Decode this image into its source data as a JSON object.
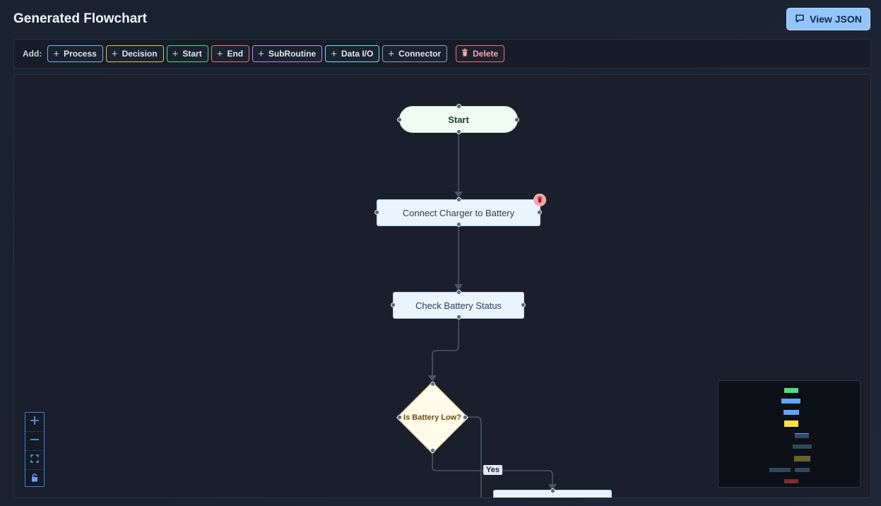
{
  "header": {
    "title": "Generated Flowchart",
    "view_json_label": "View JSON"
  },
  "toolbar": {
    "add_label": "Add:",
    "buttons": [
      "Process",
      "Decision",
      "Start",
      "End",
      "SubRoutine",
      "Data I/O",
      "Connector"
    ],
    "delete_label": "Delete"
  },
  "nodes": {
    "start": "Start",
    "process1": "Connect Charger to Battery",
    "process2": "Check Battery Status",
    "decision": "Is Battery Low?",
    "process3": ""
  },
  "edge_labels": {
    "yes": "Yes"
  },
  "colors": {
    "accent": "#93c5fd",
    "start_fill": "#effdf3",
    "process_fill": "#eaf4fd",
    "decision_fill": "#fffbe8",
    "edge": "#4b5567",
    "controls_border": "#3b82f6"
  },
  "icons": {
    "view_json": "message-icon",
    "add": "plus-icon",
    "delete": "trash-icon",
    "zoom_in": "plus-icon",
    "zoom_out": "minus-icon",
    "fit": "fit-view-icon",
    "lock": "lock-icon"
  }
}
